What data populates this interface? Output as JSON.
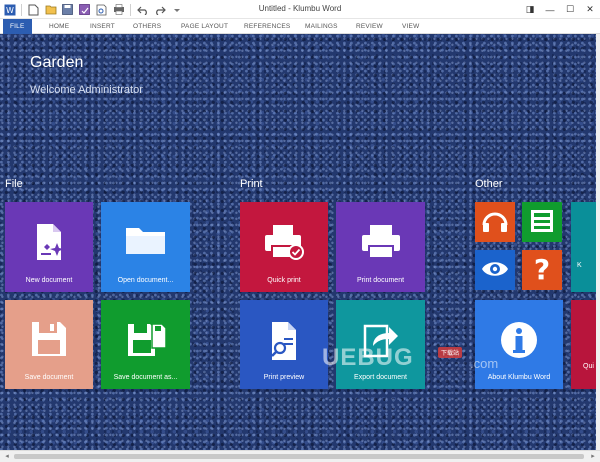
{
  "window": {
    "title": "Untitled - Klumbu Word",
    "controls": [
      "◨",
      "—",
      "☐",
      "✕"
    ]
  },
  "ribbon": {
    "tabs": [
      "FILE",
      "HOME",
      "INSERT",
      "OTHERS",
      "PAGE LAYOUT",
      "REFERENCES",
      "MAILINGS",
      "REVIEW",
      "VIEW"
    ],
    "active": "FILE"
  },
  "backstage": {
    "app_title": "Garden",
    "welcome": "Welcome Administrator",
    "groups": {
      "file": "File",
      "print": "Print",
      "other": "Other"
    },
    "tiles": {
      "new_document": "New document",
      "open_document": "Open document...",
      "save_document": "Save document",
      "save_document_as": "Save document as...",
      "quick_print": "Quick print",
      "print_document": "Print document",
      "print_preview": "Print preview",
      "export_document": "Export document",
      "about": "About Klumbu Word",
      "partial_right_top": "K",
      "partial_right_bottom": "Qui"
    }
  },
  "watermark": {
    "text": "UEBUG",
    "domain": ".com",
    "badge": "下载站"
  },
  "colors": {
    "accent": "#2c5db1",
    "tile_purple": "#6a38b6",
    "tile_blue": "#2b83e6",
    "tile_salmon": "#e59f8a",
    "tile_green": "#109c2e",
    "tile_crimson": "#c3173e",
    "tile_navy": "#2a57c2",
    "tile_teal": "#0f979e",
    "tile_orange": "#e0501c",
    "tile_small_blue": "#1b63cc",
    "tile_about": "#2f7ae6",
    "tile_partial_teal": "#0a8f99",
    "tile_partial_red": "#b8153c"
  }
}
